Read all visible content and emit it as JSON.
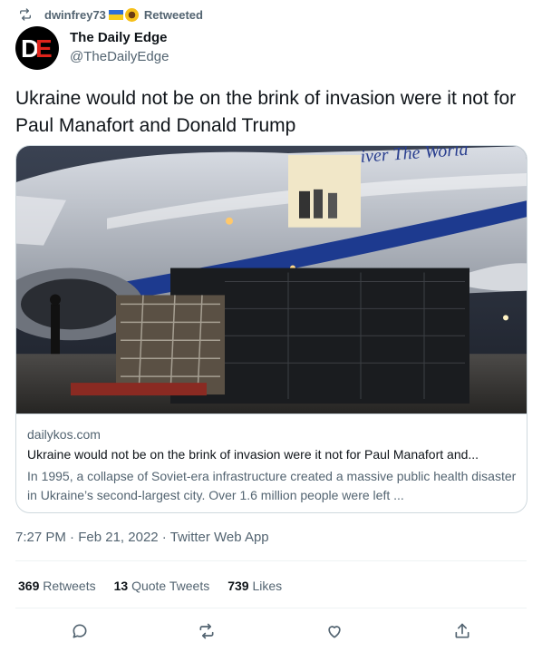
{
  "retweet": {
    "user": "dwinfrey73",
    "label": "Retweeted",
    "icon": "retweet-icon"
  },
  "author": {
    "avatar_letters": [
      "D",
      "E"
    ],
    "display_name": "The Daily Edge",
    "handle": "@TheDailyEdge"
  },
  "tweet": {
    "text": "Ukraine would not be on the brink of invasion were it not for Paul Manafort and Donald Trump"
  },
  "card": {
    "domain": "dailykos.com",
    "title": "Ukraine would not be on the brink of invasion were it not for Paul Manafort and...",
    "description": "In 1995, a collapse of Soviet-era infrastructure created a massive public health disaster in Ukraine’s second-largest city. Over 1.6 million people were left ...",
    "image_text": "iver The World"
  },
  "meta": {
    "time": "7:27 PM",
    "date": "Feb 21, 2022",
    "source": "Twitter Web App",
    "separator": "·"
  },
  "stats": {
    "retweets_count": "369",
    "retweets_label": "Retweets",
    "quotes_count": "13",
    "quotes_label": "Quote Tweets",
    "likes_count": "739",
    "likes_label": "Likes"
  },
  "colors": {
    "secondary_text": "#536471",
    "divider": "#eff3f4",
    "border": "#cfd9de"
  },
  "actions": [
    "reply-icon",
    "retweet-icon",
    "like-icon",
    "share-icon"
  ]
}
